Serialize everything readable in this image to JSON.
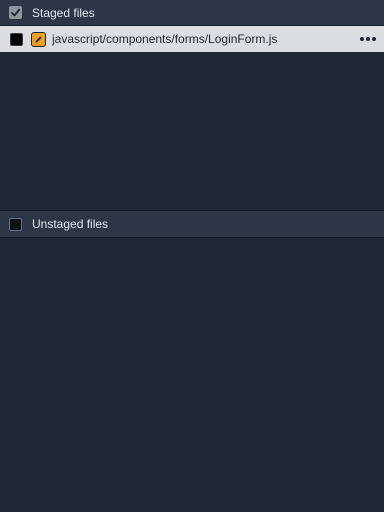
{
  "staged": {
    "title": "Staged files",
    "checked": true,
    "files": [
      {
        "path": "javascript/components/forms/LoginForm.js",
        "status_icon": "pencil-icon",
        "status_color": "#f0a020"
      }
    ]
  },
  "unstaged": {
    "title": "Unstaged files",
    "checked": false,
    "files": []
  }
}
